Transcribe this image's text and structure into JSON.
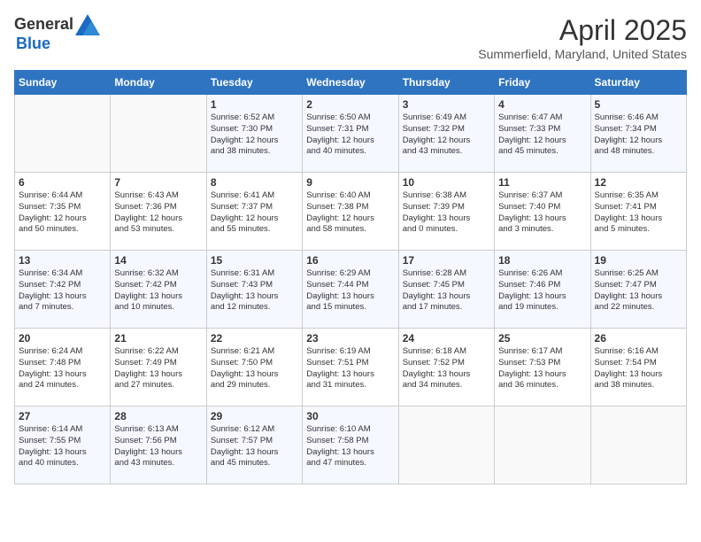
{
  "header": {
    "logo_general": "General",
    "logo_blue": "Blue",
    "title": "April 2025",
    "location": "Summerfield, Maryland, United States"
  },
  "weekdays": [
    "Sunday",
    "Monday",
    "Tuesday",
    "Wednesday",
    "Thursday",
    "Friday",
    "Saturday"
  ],
  "weeks": [
    [
      {
        "day": "",
        "detail": ""
      },
      {
        "day": "",
        "detail": ""
      },
      {
        "day": "1",
        "detail": "Sunrise: 6:52 AM\nSunset: 7:30 PM\nDaylight: 12 hours\nand 38 minutes."
      },
      {
        "day": "2",
        "detail": "Sunrise: 6:50 AM\nSunset: 7:31 PM\nDaylight: 12 hours\nand 40 minutes."
      },
      {
        "day": "3",
        "detail": "Sunrise: 6:49 AM\nSunset: 7:32 PM\nDaylight: 12 hours\nand 43 minutes."
      },
      {
        "day": "4",
        "detail": "Sunrise: 6:47 AM\nSunset: 7:33 PM\nDaylight: 12 hours\nand 45 minutes."
      },
      {
        "day": "5",
        "detail": "Sunrise: 6:46 AM\nSunset: 7:34 PM\nDaylight: 12 hours\nand 48 minutes."
      }
    ],
    [
      {
        "day": "6",
        "detail": "Sunrise: 6:44 AM\nSunset: 7:35 PM\nDaylight: 12 hours\nand 50 minutes."
      },
      {
        "day": "7",
        "detail": "Sunrise: 6:43 AM\nSunset: 7:36 PM\nDaylight: 12 hours\nand 53 minutes."
      },
      {
        "day": "8",
        "detail": "Sunrise: 6:41 AM\nSunset: 7:37 PM\nDaylight: 12 hours\nand 55 minutes."
      },
      {
        "day": "9",
        "detail": "Sunrise: 6:40 AM\nSunset: 7:38 PM\nDaylight: 12 hours\nand 58 minutes."
      },
      {
        "day": "10",
        "detail": "Sunrise: 6:38 AM\nSunset: 7:39 PM\nDaylight: 13 hours\nand 0 minutes."
      },
      {
        "day": "11",
        "detail": "Sunrise: 6:37 AM\nSunset: 7:40 PM\nDaylight: 13 hours\nand 3 minutes."
      },
      {
        "day": "12",
        "detail": "Sunrise: 6:35 AM\nSunset: 7:41 PM\nDaylight: 13 hours\nand 5 minutes."
      }
    ],
    [
      {
        "day": "13",
        "detail": "Sunrise: 6:34 AM\nSunset: 7:42 PM\nDaylight: 13 hours\nand 7 minutes."
      },
      {
        "day": "14",
        "detail": "Sunrise: 6:32 AM\nSunset: 7:42 PM\nDaylight: 13 hours\nand 10 minutes."
      },
      {
        "day": "15",
        "detail": "Sunrise: 6:31 AM\nSunset: 7:43 PM\nDaylight: 13 hours\nand 12 minutes."
      },
      {
        "day": "16",
        "detail": "Sunrise: 6:29 AM\nSunset: 7:44 PM\nDaylight: 13 hours\nand 15 minutes."
      },
      {
        "day": "17",
        "detail": "Sunrise: 6:28 AM\nSunset: 7:45 PM\nDaylight: 13 hours\nand 17 minutes."
      },
      {
        "day": "18",
        "detail": "Sunrise: 6:26 AM\nSunset: 7:46 PM\nDaylight: 13 hours\nand 19 minutes."
      },
      {
        "day": "19",
        "detail": "Sunrise: 6:25 AM\nSunset: 7:47 PM\nDaylight: 13 hours\nand 22 minutes."
      }
    ],
    [
      {
        "day": "20",
        "detail": "Sunrise: 6:24 AM\nSunset: 7:48 PM\nDaylight: 13 hours\nand 24 minutes."
      },
      {
        "day": "21",
        "detail": "Sunrise: 6:22 AM\nSunset: 7:49 PM\nDaylight: 13 hours\nand 27 minutes."
      },
      {
        "day": "22",
        "detail": "Sunrise: 6:21 AM\nSunset: 7:50 PM\nDaylight: 13 hours\nand 29 minutes."
      },
      {
        "day": "23",
        "detail": "Sunrise: 6:19 AM\nSunset: 7:51 PM\nDaylight: 13 hours\nand 31 minutes."
      },
      {
        "day": "24",
        "detail": "Sunrise: 6:18 AM\nSunset: 7:52 PM\nDaylight: 13 hours\nand 34 minutes."
      },
      {
        "day": "25",
        "detail": "Sunrise: 6:17 AM\nSunset: 7:53 PM\nDaylight: 13 hours\nand 36 minutes."
      },
      {
        "day": "26",
        "detail": "Sunrise: 6:16 AM\nSunset: 7:54 PM\nDaylight: 13 hours\nand 38 minutes."
      }
    ],
    [
      {
        "day": "27",
        "detail": "Sunrise: 6:14 AM\nSunset: 7:55 PM\nDaylight: 13 hours\nand 40 minutes."
      },
      {
        "day": "28",
        "detail": "Sunrise: 6:13 AM\nSunset: 7:56 PM\nDaylight: 13 hours\nand 43 minutes."
      },
      {
        "day": "29",
        "detail": "Sunrise: 6:12 AM\nSunset: 7:57 PM\nDaylight: 13 hours\nand 45 minutes."
      },
      {
        "day": "30",
        "detail": "Sunrise: 6:10 AM\nSunset: 7:58 PM\nDaylight: 13 hours\nand 47 minutes."
      },
      {
        "day": "",
        "detail": ""
      },
      {
        "day": "",
        "detail": ""
      },
      {
        "day": "",
        "detail": ""
      }
    ]
  ]
}
